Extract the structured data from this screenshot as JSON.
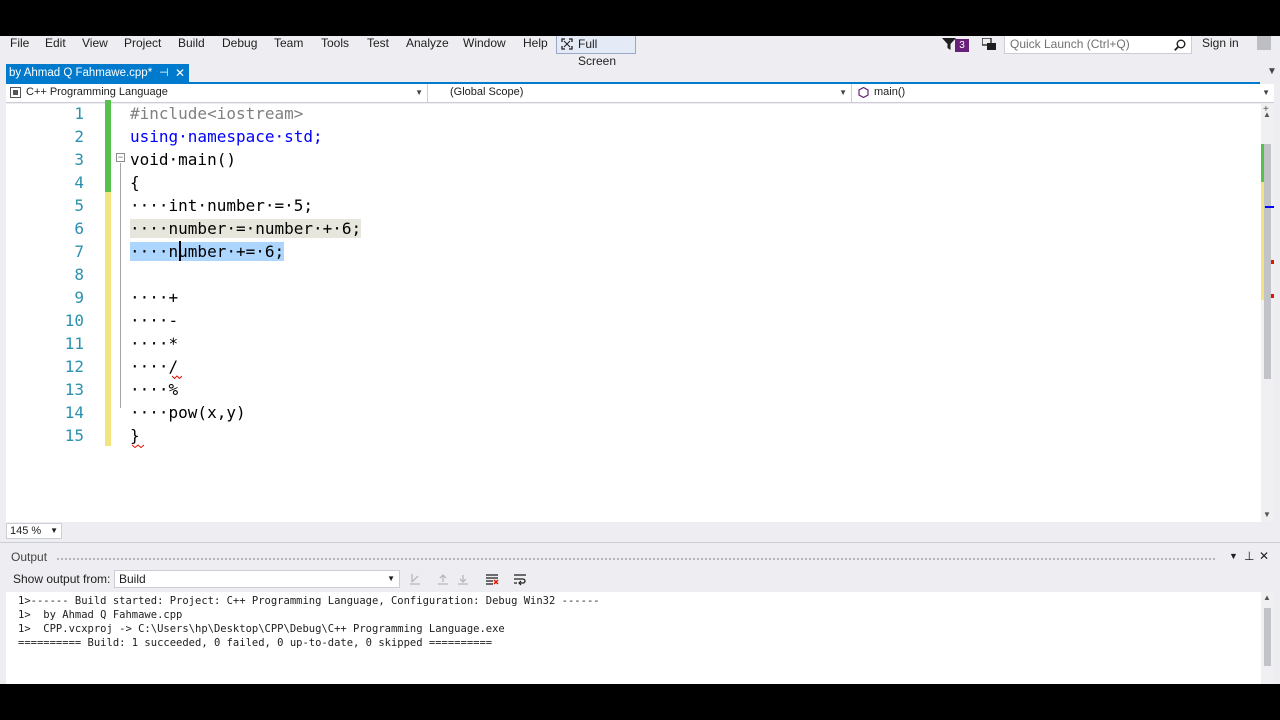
{
  "menu": {
    "items": [
      "File",
      "Edit",
      "View",
      "Project",
      "Build",
      "Debug",
      "Team",
      "Tools",
      "Test",
      "Analyze",
      "Window",
      "Help"
    ],
    "full_screen": "Full Screen",
    "notifications_count": "3",
    "quick_launch_placeholder": "Quick Launch (Ctrl+Q)",
    "sign_in": "Sign in"
  },
  "tab": {
    "title": "by Ahmad Q Fahmawe.cpp*",
    "pin_glyph": "⊣",
    "close_glyph": "✕"
  },
  "navbar": {
    "project": "C++ Programming Language",
    "scope": "(Global Scope)",
    "member": "main()"
  },
  "code": {
    "line_numbers": [
      "1",
      "2",
      "3",
      "4",
      "5",
      "6",
      "7",
      "8",
      "9",
      "10",
      "11",
      "12",
      "13",
      "14",
      "15"
    ],
    "lines": [
      "#include<iostream>",
      "using·namespace·std;",
      "void·main()",
      "{",
      "····int·number·=·5;",
      "····number·=·number·+·6;",
      "····number·+=·6;",
      "",
      "····+",
      "····-",
      "····*",
      "····/",
      "····%",
      "····pow(x,y)",
      "}"
    ]
  },
  "zoom": "145 %",
  "output": {
    "title": "Output",
    "show_from_label": "Show output from:",
    "source": "Build",
    "lines": [
      "1>------ Build started: Project: C++ Programming Language, Configuration: Debug Win32 ------",
      "1>  by Ahmad Q Fahmawe.cpp",
      "1>  CPP.vcxproj -> C:\\Users\\hp\\Desktop\\CPP\\Debug\\C++ Programming Language.exe",
      "========== Build: 1 succeeded, 0 failed, 0 up-to-date, 0 skipped =========="
    ]
  },
  "colors": {
    "accent": "#007acc",
    "keyword": "#0000ff",
    "line_number": "#2b91af",
    "change_saved": "#57c24b",
    "change_unsaved": "#f2e47f"
  }
}
